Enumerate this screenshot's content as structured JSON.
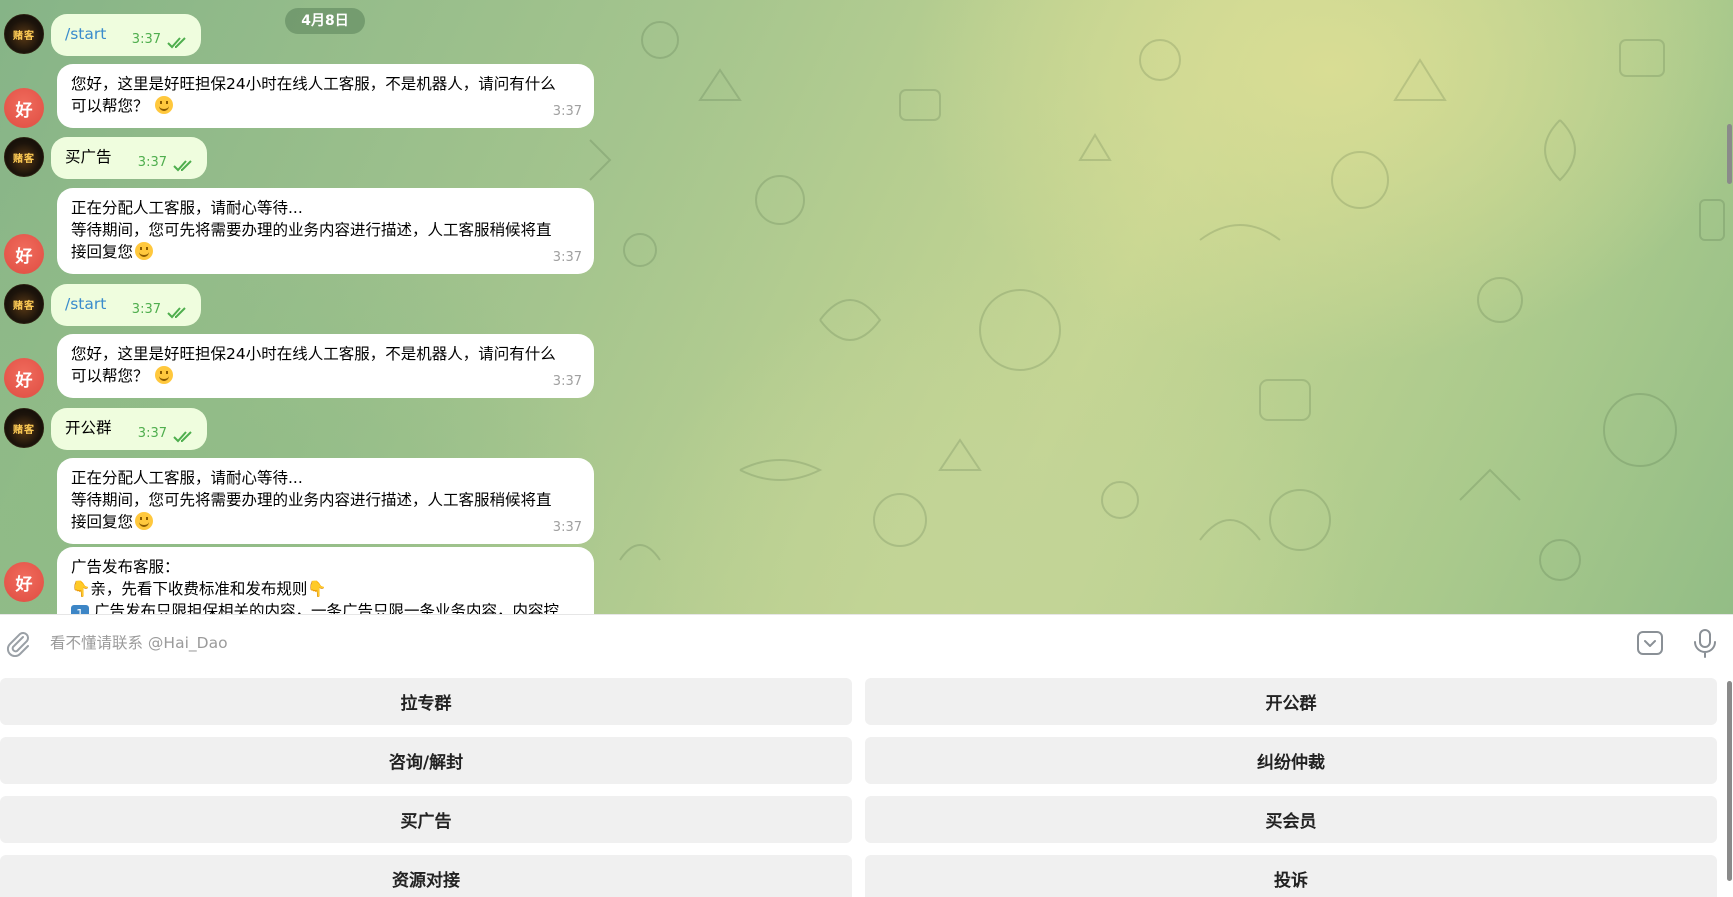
{
  "chat": {
    "date_label": "4月8日",
    "messages": [
      {
        "type": "out",
        "text": "/start",
        "time": "3:37"
      },
      {
        "type": "in",
        "lines": [
          "您好，这里是好旺担保24小时在线人工客服，不是机器人，请问有什么",
          "可以帮您？"
        ],
        "time": "3:37",
        "avatar": "好"
      },
      {
        "type": "out",
        "text": "买广告",
        "time": "3:37"
      },
      {
        "type": "in",
        "lines": [
          "正在分配人工客服，请耐心等待...",
          "等待期间，您可先将需要办理的业务内容进行描述，人工客服稍候将直",
          "接回复您"
        ],
        "time": "3:37",
        "avatar": "好"
      },
      {
        "type": "out",
        "text": "/start",
        "time": "3:37"
      },
      {
        "type": "in",
        "lines": [
          "您好，这里是好旺担保24小时在线人工客服，不是机器人，请问有什么",
          "可以帮您？"
        ],
        "time": "3:37",
        "avatar": "好"
      },
      {
        "type": "out",
        "text": "开公群",
        "time": "3:37"
      },
      {
        "type": "in",
        "lines": [
          "正在分配人工客服，请耐心等待...",
          "等待期间，您可先将需要办理的业务内容进行描述，人工客服稍候将直",
          "接回复您"
        ],
        "time": "3:37"
      },
      {
        "type": "in",
        "lines": [
          "广告发布客服：",
          "亲，先看下收费标准和发布规则",
          "广告发布只限担保相关的内容，一条广告只限一条业务内容，内容控"
        ],
        "avatar": "好"
      }
    ],
    "user_avatar_text": "赌客"
  },
  "input": {
    "placeholder": "看不懂请联系 @Hai_Dao"
  },
  "keyboard": {
    "rows": [
      [
        "拉专群",
        "开公群"
      ],
      [
        "咨询/解封",
        "纠纷仲裁"
      ],
      [
        "买广告",
        "买会员"
      ],
      [
        "资源对接",
        "投诉"
      ]
    ]
  },
  "colors": {
    "incoming_bubble": "#ffffff",
    "outgoing_bubble": "#effdde",
    "read_ticks": "#4fae4e",
    "bot_avatar": "#e8584b",
    "keyboard_button": "#f0f0f0"
  }
}
